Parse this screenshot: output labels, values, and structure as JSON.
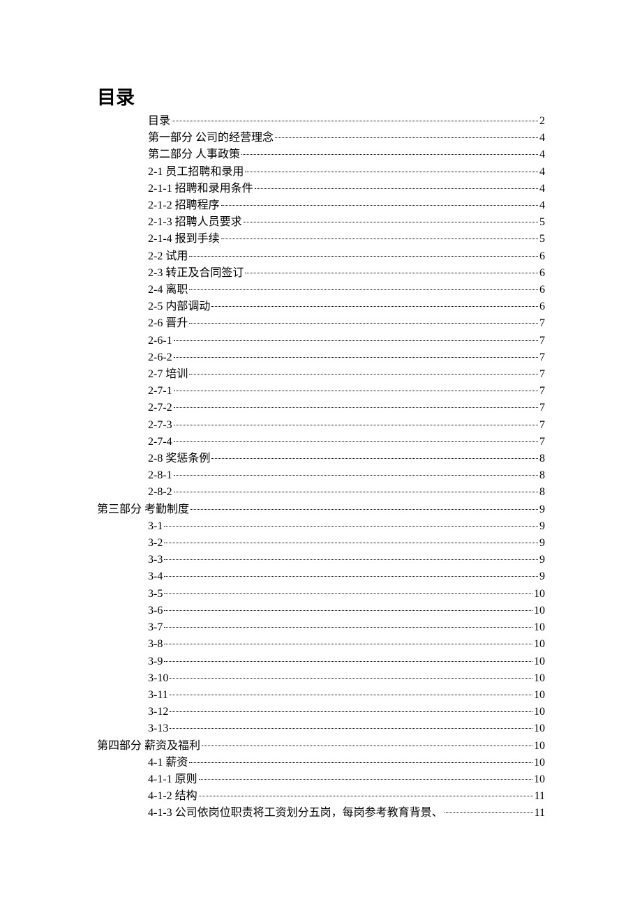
{
  "title": "目录",
  "toc": [
    {
      "label": "目录",
      "page": "2",
      "indent": 2
    },
    {
      "label": "第一部分  公司的经营理念",
      "page": "4",
      "indent": 2
    },
    {
      "label": "第二部分  人事政策",
      "page": "4",
      "indent": 2
    },
    {
      "label": "2-1  员工招聘和录用",
      "page": "4",
      "indent": 2
    },
    {
      "label": "2-1-1  招聘和录用条件",
      "page": "4",
      "indent": 2
    },
    {
      "label": "2-1-2  招聘程序",
      "page": "4",
      "indent": 2
    },
    {
      "label": "2-1-3  招聘人员要求",
      "page": "5",
      "indent": 2
    },
    {
      "label": "2-1-4  报到手续",
      "page": "5",
      "indent": 2
    },
    {
      "label": "2-2  试用",
      "page": "6",
      "indent": 2
    },
    {
      "label": "2-3  转正及合同签订",
      "page": "6",
      "indent": 2
    },
    {
      "label": "2-4  离职",
      "page": "6",
      "indent": 2
    },
    {
      "label": "2-5  内部调动",
      "page": "6",
      "indent": 2
    },
    {
      "label": "2-6  晋升",
      "page": "7",
      "indent": 2
    },
    {
      "label": "2-6-1",
      "page": "7",
      "indent": 2
    },
    {
      "label": "2-6-2",
      "page": "7",
      "indent": 2
    },
    {
      "label": "2-7  培训",
      "page": "7",
      "indent": 2
    },
    {
      "label": "2-7-1",
      "page": "7",
      "indent": 2
    },
    {
      "label": "2-7-2",
      "page": "7",
      "indent": 2
    },
    {
      "label": "2-7-3",
      "page": "7",
      "indent": 2
    },
    {
      "label": "2-7-4",
      "page": "7",
      "indent": 2
    },
    {
      "label": "2-8  奖惩条例",
      "page": "8",
      "indent": 2
    },
    {
      "label": "2-8-1",
      "page": "8",
      "indent": 2
    },
    {
      "label": "2-8-2",
      "page": "8",
      "indent": 2
    },
    {
      "label": "第三部分  考勤制度",
      "page": "9",
      "indent": 0
    },
    {
      "label": "3-1",
      "page": "9",
      "indent": 2
    },
    {
      "label": "3-2",
      "page": "9",
      "indent": 2
    },
    {
      "label": "3-3",
      "page": "9",
      "indent": 2
    },
    {
      "label": "3-4",
      "page": "9",
      "indent": 2
    },
    {
      "label": "3-5",
      "page": "10",
      "indent": 2
    },
    {
      "label": "3-6",
      "page": "10",
      "indent": 2
    },
    {
      "label": "3-7",
      "page": "10",
      "indent": 2
    },
    {
      "label": "3-8",
      "page": "10",
      "indent": 2
    },
    {
      "label": "3-9",
      "page": "10",
      "indent": 2
    },
    {
      "label": "3-10",
      "page": "10",
      "indent": 2
    },
    {
      "label": "3-11",
      "page": "10",
      "indent": 2
    },
    {
      "label": "3-12",
      "page": "10",
      "indent": 2
    },
    {
      "label": "3-13",
      "page": "10",
      "indent": 2
    },
    {
      "label": "第四部分  薪资及福利",
      "page": "10",
      "indent": 0
    },
    {
      "label": "4-1 薪资",
      "page": "10",
      "indent": 2
    },
    {
      "label": "4-1-1  原则",
      "page": "10",
      "indent": 2
    },
    {
      "label": "4-1-2  结构",
      "page": "11",
      "indent": 2
    },
    {
      "label": "4-1-3  公司依岗位职责将工资划分五岗，每岗参考教育背景、",
      "page": "11",
      "indent": 2
    }
  ]
}
